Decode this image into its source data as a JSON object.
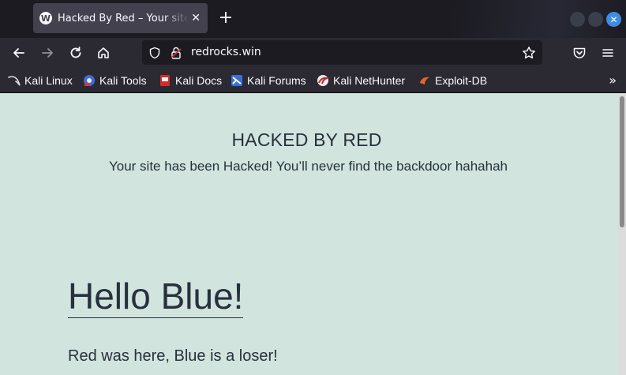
{
  "tab": {
    "title": "Hacked By Red – Your site has been Hacked!",
    "favicon": "wordpress-icon"
  },
  "toolbar": {
    "url": "redrocks.win"
  },
  "bookmarks": [
    {
      "label": "Kali Linux",
      "icon": "kali-dragon-icon"
    },
    {
      "label": "Kali Tools",
      "icon": "kali-tools-icon"
    },
    {
      "label": "Kali Docs",
      "icon": "kali-docs-icon"
    },
    {
      "label": "Kali Forums",
      "icon": "kali-forums-icon"
    },
    {
      "label": "Kali NetHunter",
      "icon": "nethunter-icon"
    },
    {
      "label": "Exploit-DB",
      "icon": "exploit-db-icon"
    }
  ],
  "page": {
    "site_title": "HACKED BY RED",
    "site_description": "Your site has been Hacked! You’ll never find the backdoor hahahah",
    "post_title": "Hello Blue!",
    "post_body": "Red was here, Blue is a loser!"
  },
  "colors": {
    "background": "#d1e4dd",
    "text": "#28303d",
    "chrome_dark": "#1c1b22",
    "chrome": "#2b2a33",
    "accent": "#3d8ce6"
  }
}
